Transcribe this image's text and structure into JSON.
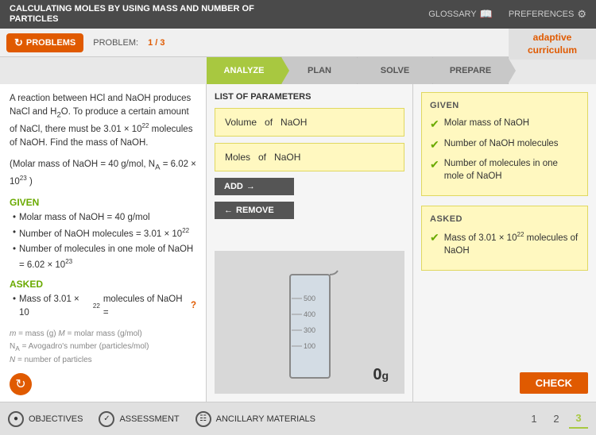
{
  "topbar": {
    "title": "CALCULATING MOLES BY USING MASS AND NUMBER OF PARTICLES",
    "glossary": "GLOSSARY",
    "preferences": "PREFERENCES"
  },
  "logo": {
    "line1": "adaptive",
    "line2": "curriculum"
  },
  "problems": {
    "button_label": "PROBLEMS",
    "problem_label": "PROBLEM:",
    "problem_count": "1 / 3"
  },
  "steps": [
    {
      "label": "ANALYZE",
      "active": true
    },
    {
      "label": "PLAN",
      "active": false
    },
    {
      "label": "SOLVE",
      "active": false
    },
    {
      "label": "PREPARE",
      "active": false
    }
  ],
  "left_panel": {
    "problem_text": "A reaction between HCl and NaOH produces NaCl and H₂O. To produce a certain amount of NaCl, there must be 3.01 × 10²² molecules of NaOH. Find the mass of NaOH.",
    "molar_mass_note": "(Molar mass of NaOH = 40 g/mol, Nₐ = 6.02 × 10²³ )",
    "given_label": "GIVEN",
    "given_items": [
      "Molar mass of NaOH = 40 g/mol",
      "Number of NaOH molecules = 3.01 × 10²²",
      "Number of molecules in one mole of NaOH = 6.02 × 10²³"
    ],
    "asked_label": "ASKED",
    "asked_item": "Mass of 3.01 × 10²² molecules of NaOH =",
    "asked_q": "?",
    "formula_hint_lines": [
      "m = mass (g) M = molar mass (g/mol)",
      "Nₐ = Avogadro's number (particles/mol)",
      "N = number of particles"
    ]
  },
  "middle_panel": {
    "title": "LIST OF PARAMETERS",
    "params": [
      "Volume  of  NaOH",
      "Moles  of  NaOH"
    ],
    "add_label": "ADD",
    "remove_label": "REMOVE",
    "mass_value": "0",
    "mass_unit": "g"
  },
  "right_panel": {
    "given_title": "GIVEN",
    "given_items": [
      "Molar mass of NaOH",
      "Number of NaOH molecules",
      "Number of molecules in one mole of NaOH"
    ],
    "asked_title": "ASKED",
    "asked_item": "Mass of 3.01 × 10²² molecules of NaOH"
  },
  "check_button": "CHECK",
  "bottom_bar": {
    "objectives": "OBJECTIVES",
    "assessment": "ASSESSMENT",
    "ancillary_materials": "ANCILLARY MATERIALS",
    "pages": [
      "1",
      "2",
      "3"
    ],
    "active_page": "3"
  }
}
